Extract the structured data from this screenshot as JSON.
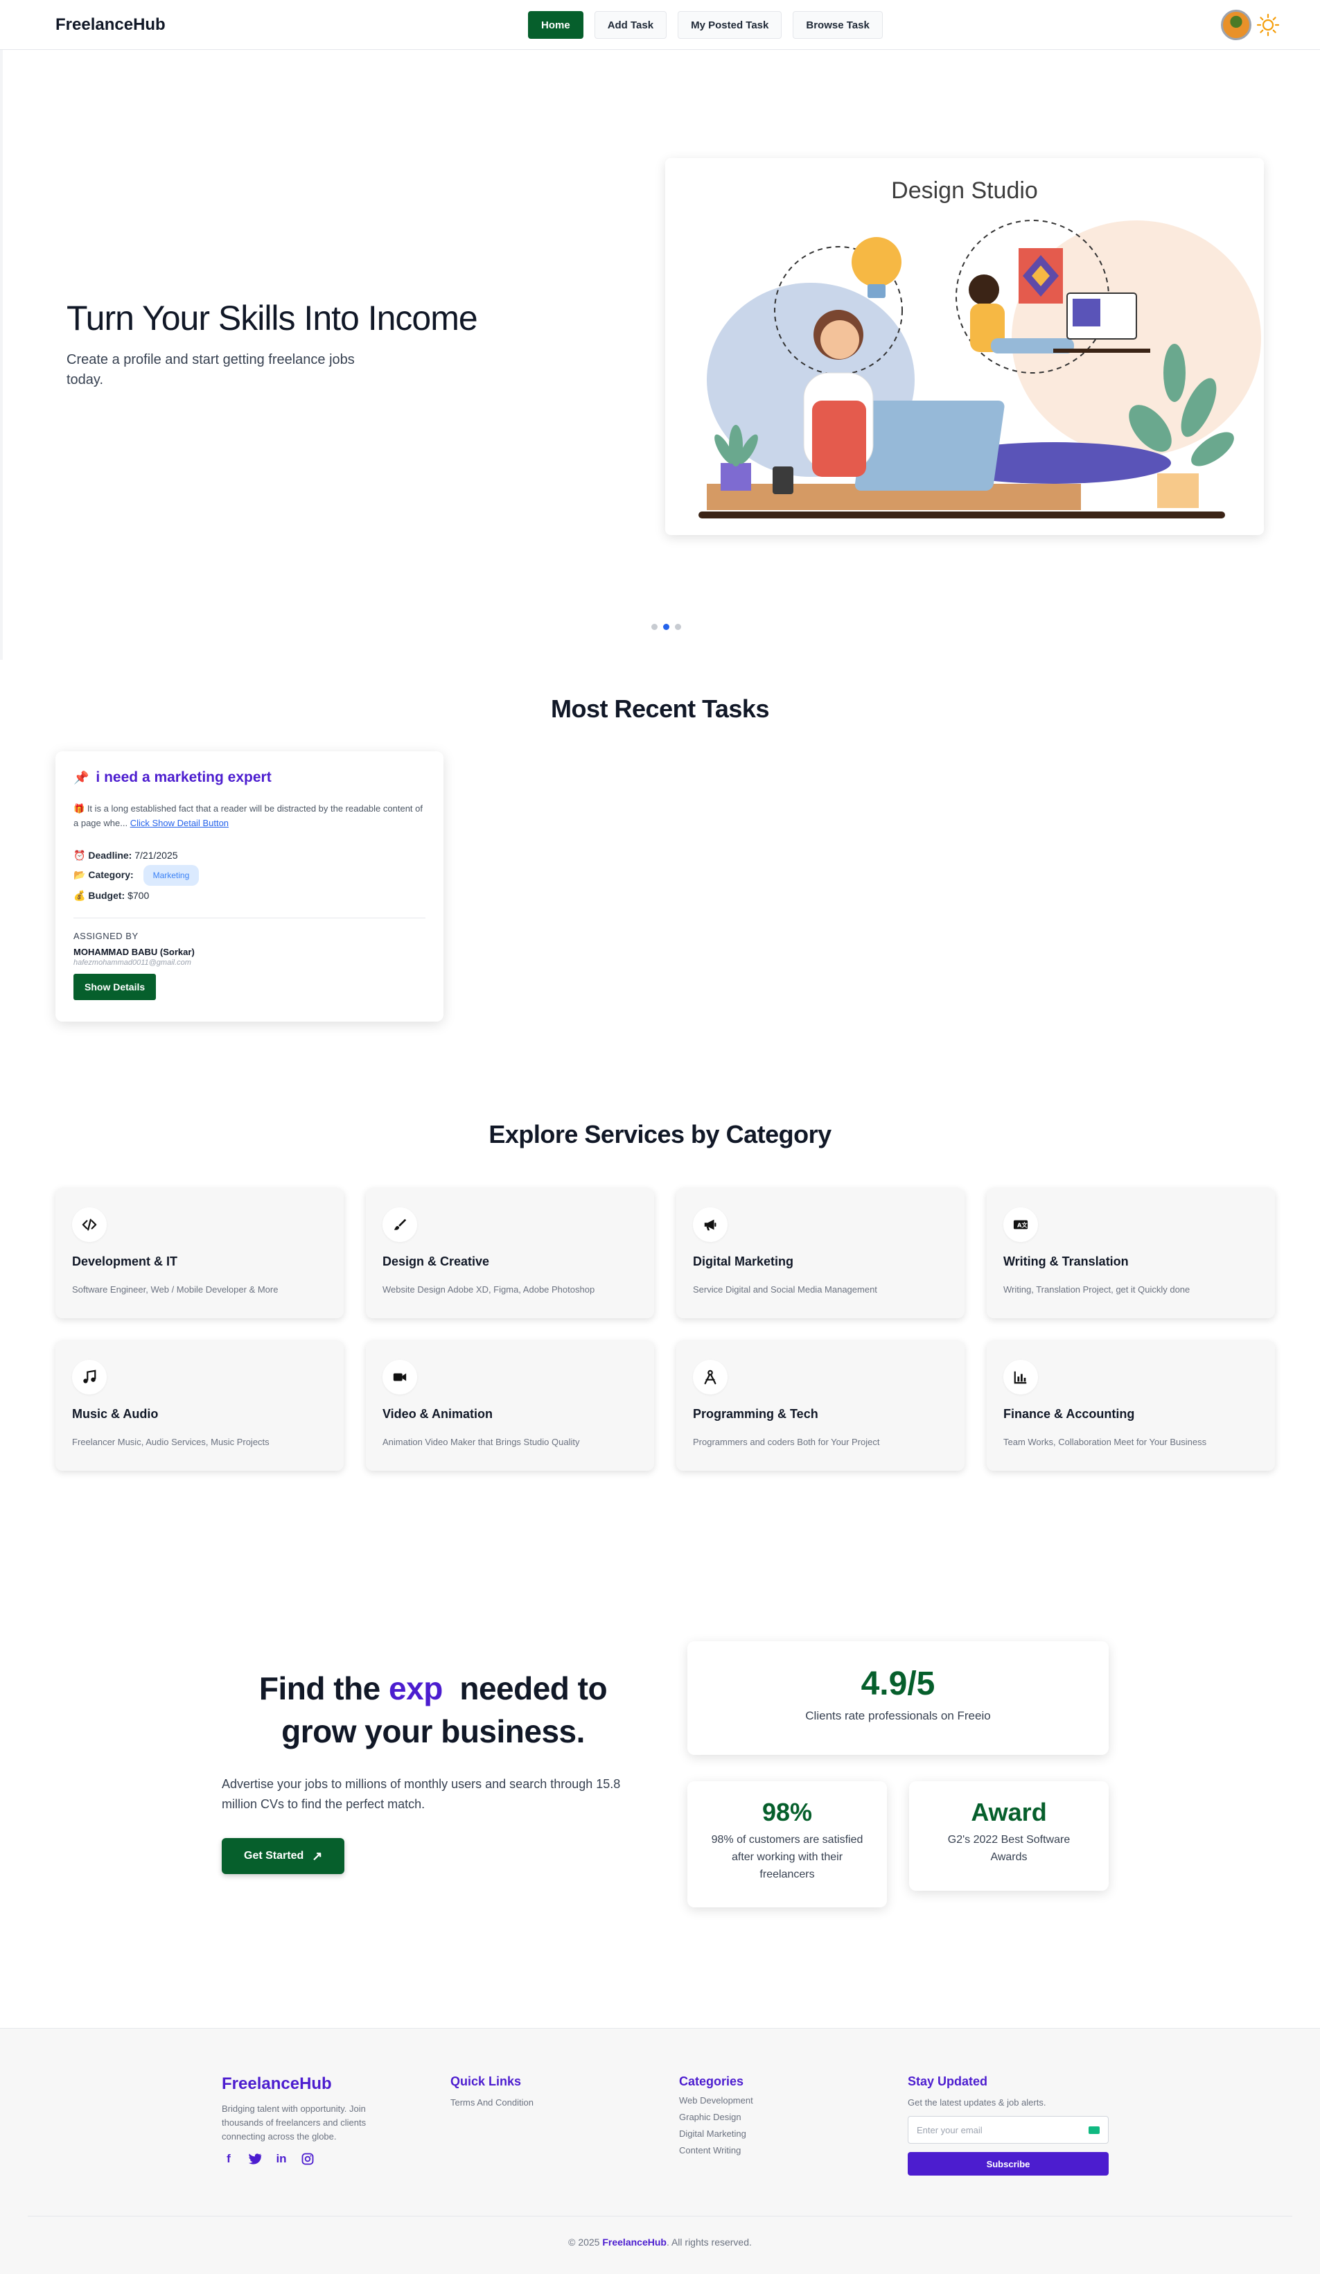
{
  "nav": {
    "brand": "FreelanceHub",
    "links": [
      {
        "label": "Home",
        "active": true
      },
      {
        "label": "Add Task",
        "active": false
      },
      {
        "label": "My Posted Task",
        "active": false
      },
      {
        "label": "Browse Task",
        "active": false
      }
    ],
    "theme_icon": "sun-icon"
  },
  "hero": {
    "title": "Turn Your Skills Into Income",
    "subtitle": "Create a profile and start getting freelance jobs today.",
    "image_heading": "Design Studio",
    "slides_total": 3,
    "active_slide": 2
  },
  "recent_tasks": {
    "heading": "Most Recent Tasks",
    "tasks": [
      {
        "title": "i need a marketing expert",
        "description": "It is a long established fact that a reader will be distracted by the readable content of a page whe...",
        "detail_link": "Click Show Detail Button",
        "deadline_label": "Deadline:",
        "deadline": "7/21/2025",
        "category_label": "Category:",
        "category": "Marketing",
        "budget_label": "Budget:",
        "budget": "$700",
        "assigned_label": "ASSIGNED BY",
        "assigned_name": "MOHAMMAD BABU (Sorkar)",
        "assigned_email": "hafezmohammad0011@gmail.com",
        "button": "Show Details"
      }
    ]
  },
  "categories": {
    "heading": "Explore Services by Category",
    "items": [
      {
        "icon": "code-icon",
        "name": "Development & IT",
        "desc": "Software Engineer, Web / Mobile Developer & More"
      },
      {
        "icon": "paintbrush-icon",
        "name": "Design & Creative",
        "desc": "Website Design Adobe XD, Figma, Adobe Photoshop"
      },
      {
        "icon": "megaphone-icon",
        "name": "Digital Marketing",
        "desc": "Service Digital and Social Media Management"
      },
      {
        "icon": "translate-icon",
        "name": "Writing & Translation",
        "desc": "Writing, Translation Project, get it Quickly done"
      },
      {
        "icon": "music-icon",
        "name": "Music & Audio",
        "desc": "Freelancer Music, Audio Services, Music Projects"
      },
      {
        "icon": "video-icon",
        "name": "Video & Animation",
        "desc": "Animation Video Maker that Brings Studio Quality"
      },
      {
        "icon": "compass-icon",
        "name": "Programming & Tech",
        "desc": "Programmers and coders Both for Your Project"
      },
      {
        "icon": "bar-chart-icon",
        "name": "Finance & Accounting",
        "desc": "Team Works, Collaboration Meet for Your Business"
      }
    ]
  },
  "stats": {
    "heading_prefix": "Find the",
    "heading_accent": "exp",
    "heading_suffix": "needed to grow your business.",
    "text": "Advertise your jobs to millions of monthly users and search through 15.8 million CVs to find the perfect match.",
    "cta": "Get Started",
    "cards": [
      {
        "value": "4.9/5",
        "label": "Clients rate professionals on Freeio"
      },
      {
        "value": "98%",
        "label": "98% of customers are satisfied after working with their freelancers"
      },
      {
        "value": "Award",
        "label": "G2's 2022 Best Software Awards"
      }
    ]
  },
  "footer": {
    "brand": "FreelanceHub",
    "tagline": "Bridging talent with opportunity. Join thousands of freelancers and clients connecting across the globe.",
    "social": [
      "facebook-icon",
      "twitter-icon",
      "linkedin-icon",
      "instagram-icon"
    ],
    "quick_links_heading": "Quick Links",
    "quick_links": [
      "Terms And Condition"
    ],
    "categories_heading": "Categories",
    "categories": [
      "Web Development",
      "Graphic Design",
      "Digital Marketing",
      "Content Writing"
    ],
    "newsletter_heading": "Stay Updated",
    "newsletter_text": "Get the latest updates & job alerts.",
    "email_placeholder": "Enter your email",
    "subscribe": "Subscribe",
    "copyright_prefix": "© 2025",
    "copyright_brand": "FreelanceHub",
    "copyright_suffix": ". All rights reserved."
  },
  "colors": {
    "primary_green": "#065f2c",
    "accent_purple": "#4c1dcf",
    "link_blue": "#2563eb"
  }
}
